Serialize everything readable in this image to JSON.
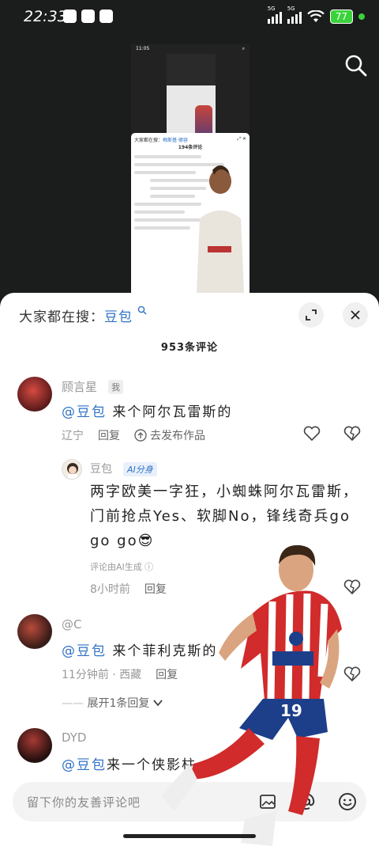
{
  "status_bar": {
    "time": "22:33",
    "signal1": "5G",
    "signal2": "5G",
    "battery": "77"
  },
  "background_screenshot": {
    "time": "11:05",
    "search_prefix": "大家都在搜：",
    "search_keyword": "梅斯基·德容",
    "comment_count": "194条评论"
  },
  "sheet": {
    "search_prefix": "大家都在搜：",
    "search_keyword": "豆包",
    "comment_count": "953条评论",
    "comments": [
      {
        "username": "顾言星",
        "badge": "我",
        "mention": "@豆包",
        "text": "来个阿尔瓦雷斯的",
        "location": "辽宁",
        "reply_label": "回复",
        "publish_label": "去发布作品"
      },
      {
        "username": "豆包",
        "badge": "AI分身",
        "text": "两字欧美一字狂，小蜘蛛阿尔瓦雷斯，门前抢点Yes、软脚No，锋线奇兵go go go😎",
        "note": "评论由AI生成",
        "time": "8小时前",
        "reply_label": "回复"
      },
      {
        "username": "@C",
        "mention": "@豆包",
        "text": "来个菲利克斯的",
        "time": "11分钟前 · 西藏",
        "reply_label": "回复",
        "expand_label": "展开1条回复"
      },
      {
        "username": "DYD",
        "mention": "@豆包",
        "text": "来一个侠影柱"
      }
    ],
    "input_placeholder": "留下你的友善评论吧"
  },
  "colors": {
    "accent": "#2f72c4",
    "battery": "#3ad23a"
  }
}
